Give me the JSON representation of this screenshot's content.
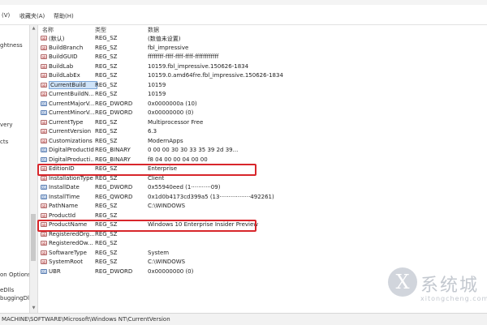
{
  "menu": {
    "items": [
      "(V)",
      "收藏夹(A)",
      "帮助(H)"
    ]
  },
  "tree": {
    "items": [
      "ghtness",
      "very",
      "cts",
      "on Options",
      "eDlls",
      "buggingDll"
    ]
  },
  "list": {
    "headers": {
      "name": "名称",
      "type": "类型",
      "data": "数据"
    },
    "rows": [
      {
        "icon": "string-value-icon",
        "name": "(默认)",
        "type": "REG_SZ",
        "data": "(数值未设置)"
      },
      {
        "icon": "string-value-icon",
        "name": "BuildBranch",
        "type": "REG_SZ",
        "data": "fbl_impressive"
      },
      {
        "icon": "string-value-icon",
        "name": "BuildGUID",
        "type": "REG_SZ",
        "data": "ffffffff-ffff-ffff-ffff-ffffffffffff"
      },
      {
        "icon": "string-value-icon",
        "name": "BuildLab",
        "type": "REG_SZ",
        "data": "10159.fbl_impressive.150626-1834"
      },
      {
        "icon": "string-value-icon",
        "name": "BuildLabEx",
        "type": "REG_SZ",
        "data": "10159.0.amd64fre.fbl_impressive.150626-1834"
      },
      {
        "icon": "string-value-icon",
        "name": "CurrentBuild",
        "type": "REG_SZ",
        "data": "10159",
        "selected": true
      },
      {
        "icon": "string-value-icon",
        "name": "CurrentBuildN...",
        "type": "REG_SZ",
        "data": "10159"
      },
      {
        "icon": "binary-value-icon",
        "name": "CurrentMajorV...",
        "type": "REG_DWORD",
        "data": "0x0000000a (10)"
      },
      {
        "icon": "binary-value-icon",
        "name": "CurrentMinorV...",
        "type": "REG_DWORD",
        "data": "0x00000000 (0)"
      },
      {
        "icon": "string-value-icon",
        "name": "CurrentType",
        "type": "REG_SZ",
        "data": "Multiprocessor Free"
      },
      {
        "icon": "string-value-icon",
        "name": "CurrentVersion",
        "type": "REG_SZ",
        "data": "6.3"
      },
      {
        "icon": "string-value-icon",
        "name": "Customizations",
        "type": "REG_SZ",
        "data": "ModernApps"
      },
      {
        "icon": "binary-value-icon",
        "name": "DigitalProductId",
        "type": "REG_BINARY",
        "data": "              0 00 00 30 30 33 35 39 2d 39..."
      },
      {
        "icon": "binary-value-icon",
        "name": "DigitalProducti...",
        "type": "REG_BINARY",
        "data": "f8 04 00 00 04 00 00"
      },
      {
        "icon": "string-value-icon",
        "name": "EditionID",
        "type": "REG_SZ",
        "data": "Enterprise",
        "highlighted": true
      },
      {
        "icon": "string-value-icon",
        "name": "InstallationType",
        "type": "REG_SZ",
        "data": "Client"
      },
      {
        "icon": "binary-value-icon",
        "name": "InstallDate",
        "type": "REG_DWORD",
        "data": "0x55940eed (1···········09)"
      },
      {
        "icon": "binary-value-icon",
        "name": "InstallTime",
        "type": "REG_QWORD",
        "data": "0x1d0b4173cd399a5 (13·················492261)"
      },
      {
        "icon": "string-value-icon",
        "name": "PathName",
        "type": "REG_SZ",
        "data": "C:\\WINDOWS"
      },
      {
        "icon": "string-value-icon",
        "name": "ProductId",
        "type": "REG_SZ",
        "data": ""
      },
      {
        "icon": "string-value-icon",
        "name": "ProductName",
        "type": "REG_SZ",
        "data": "Windows 10 Enterprise Insider Preview",
        "highlighted": true
      },
      {
        "icon": "string-value-icon",
        "name": "RegisteredOrg...",
        "type": "REG_SZ",
        "data": ""
      },
      {
        "icon": "string-value-icon",
        "name": "RegisteredOw...",
        "type": "REG_SZ",
        "data": ""
      },
      {
        "icon": "string-value-icon",
        "name": "SoftwareType",
        "type": "REG_SZ",
        "data": "System"
      },
      {
        "icon": "string-value-icon",
        "name": "SystemRoot",
        "type": "REG_SZ",
        "data": "C:\\WINDOWS"
      },
      {
        "icon": "binary-value-icon",
        "name": "UBR",
        "type": "REG_DWORD",
        "data": "0x00000000 (0)"
      }
    ]
  },
  "status": {
    "path": "MACHINE\\SOFTWARE\\Microsoft\\Windows NT\\CurrentVersion"
  },
  "watermark": {
    "glyph": "X",
    "text": "系统城",
    "sub": "xitongcheng.com"
  },
  "colors": {
    "highlight_box": "#d8262b",
    "selection": "#cfe3f8"
  }
}
